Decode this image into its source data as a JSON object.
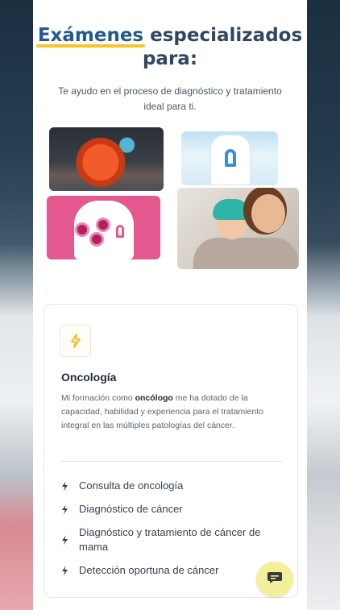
{
  "hero": {
    "title_highlight": "Exámenes",
    "title_rest": " especializados para:",
    "subtitle": "Te ayudo en el proceso de diagnóstico y tratamiento ideal para ti."
  },
  "card": {
    "icon": "lightning-icon",
    "title": "Oncología",
    "description_before": "Mi formación como ",
    "description_bold": "oncólogo",
    "description_after": " me ha dotado de la capacidad, habilidad y experiencia para el tratamiento integral en las múltiples patologías del cáncer.",
    "features": [
      "Consulta de oncología",
      "Diagnóstico de cáncer",
      "Diagnóstico y tratamiento de cáncer de mama",
      "Detección oportuna de cáncer"
    ]
  },
  "chat": {
    "icon": "chat-icon"
  },
  "colors": {
    "accent_yellow": "#f6c42b",
    "title_blue": "#24598f",
    "chat_button": "#f3ef9a"
  }
}
